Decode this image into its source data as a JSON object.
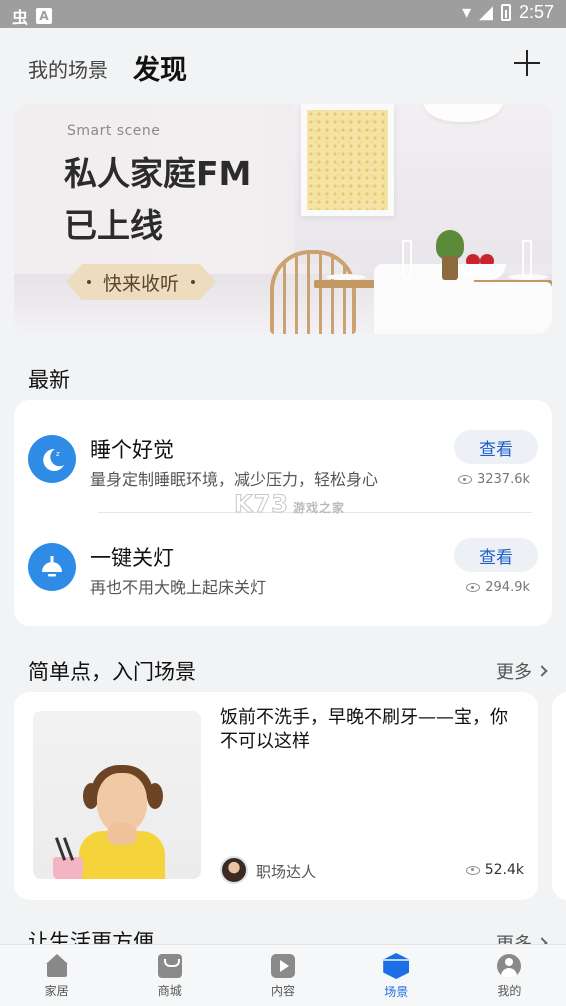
{
  "status_bar": {
    "time": "2:57",
    "app_glyph": "虫",
    "notif_glyph": "A"
  },
  "header": {
    "tab_scene": "我的场景",
    "tab_discover": "发现",
    "add_icon": "plus-icon"
  },
  "banner": {
    "eyebrow": "Smart scene",
    "headline_line1": "私人家庭FM",
    "headline_line2": "已上线",
    "cta": "快来收听"
  },
  "latest": {
    "title": "最新",
    "items": [
      {
        "title": "睡个好觉",
        "desc": "量身定制睡眠环境，减少压力，轻松身心",
        "button": "查看",
        "views": "3237.6k",
        "icon": "moon-sleep-icon"
      },
      {
        "title": "一键关灯",
        "desc": "再也不用大晚上起床关灯",
        "button": "查看",
        "views": "294.9k",
        "icon": "lamp-icon"
      }
    ],
    "watermark": "K73",
    "watermark_sub": "游戏之家"
  },
  "simple": {
    "title": "简单点，入门场景",
    "more": "更多",
    "card": {
      "title": "饭前不洗手，早晚不刷牙——宝，你不可以这样",
      "author": "职场达人",
      "views": "52.4k"
    }
  },
  "next_section": {
    "title": "让生活更方便",
    "more": "更多"
  },
  "bottom_nav": {
    "items": [
      {
        "label": "家居",
        "icon": "home-icon"
      },
      {
        "label": "商城",
        "icon": "shop-bag-icon"
      },
      {
        "label": "内容",
        "icon": "play-icon"
      },
      {
        "label": "场景",
        "icon": "scene-cube-icon"
      },
      {
        "label": "我的",
        "icon": "user-icon"
      }
    ],
    "active_index": 3
  },
  "colors": {
    "accent": "#1c6ee8",
    "view_button_bg": "#edf1f5",
    "icon_blue": "#2f8ce6",
    "cta_bg": "#eddcbe"
  }
}
